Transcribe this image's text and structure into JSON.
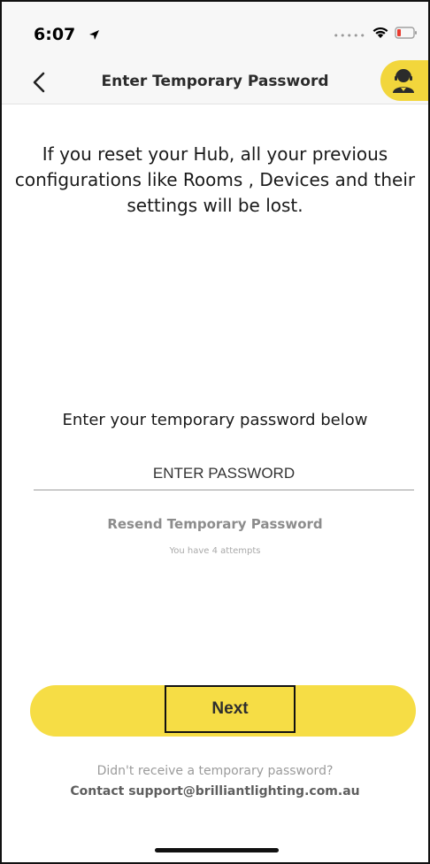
{
  "status_bar": {
    "time": "6:07",
    "icons": [
      "location-arrow-icon",
      "signal-icon",
      "wifi-icon",
      "battery-low-icon"
    ],
    "battery_color": "#e83b2f"
  },
  "nav": {
    "title": "Enter Temporary Password",
    "back_icon": "chevron-left-icon",
    "support_icon": "support-agent-icon",
    "support_color": "#f2d63c"
  },
  "content": {
    "warning": "If you reset your Hub, all your previous configurations like Rooms , Devices and their settings will be lost.",
    "prompt": "Enter your temporary password below",
    "password_placeholder": "ENTER PASSWORD",
    "password_value": "",
    "resend_label": "Resend Temporary Password",
    "attempts_text": "You have 4 attempts"
  },
  "actions": {
    "next_label": "Next",
    "accent_color": "#f6dd45"
  },
  "footer": {
    "line1": "Didn't receive a temporary password?",
    "line2": "Contact support@brilliantlighting.com.au"
  }
}
